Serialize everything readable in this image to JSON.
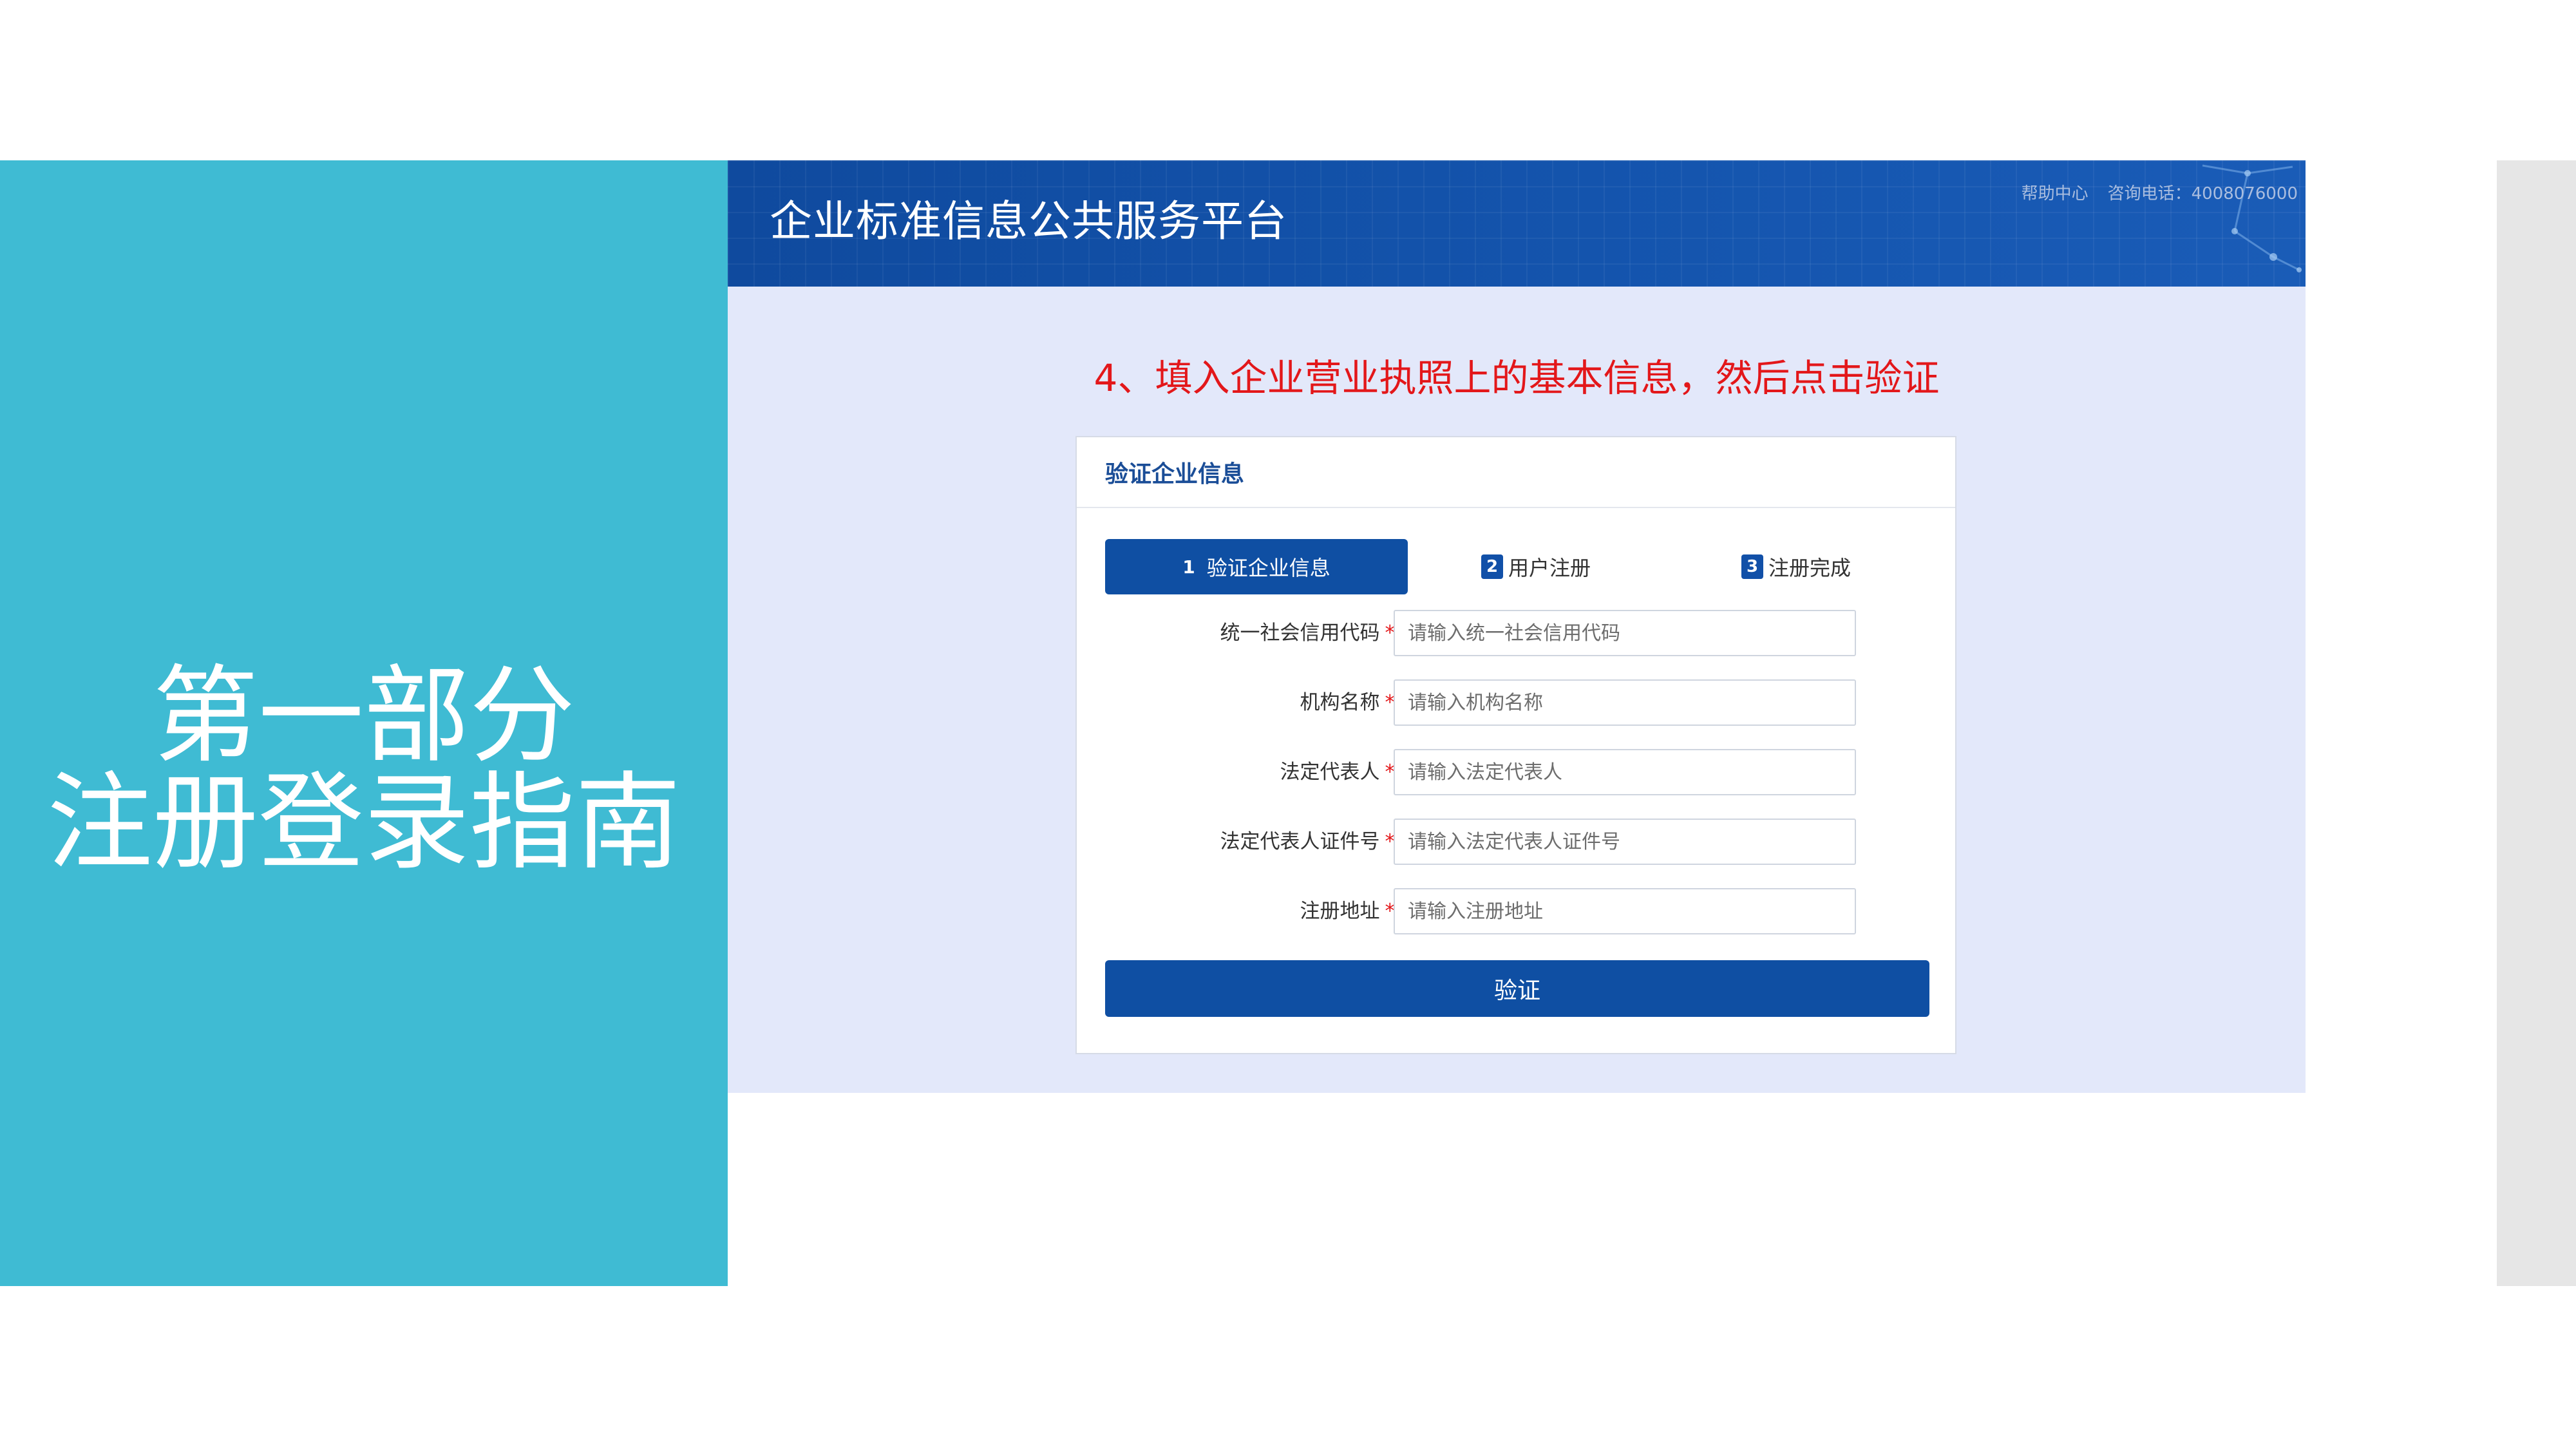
{
  "slide": {
    "title_line1": "第一部分",
    "title_line2": "注册登录指南"
  },
  "screenshot": {
    "platform_title": "企业标准信息公共服务平台",
    "help_center": "帮助中心",
    "hotline": "咨询电话：4008076000",
    "instruction": "4、填入企业营业执照上的基本信息，然后点击验证"
  },
  "card": {
    "title": "验证企业信息",
    "steps": [
      {
        "number": "1",
        "label": "验证企业信息",
        "active": true
      },
      {
        "number": "2",
        "label": "用户注册",
        "active": false
      },
      {
        "number": "3",
        "label": "注册完成",
        "active": false
      }
    ],
    "required_mark": "*",
    "fields": [
      {
        "label": "统一社会信用代码",
        "placeholder": "请输入统一社会信用代码",
        "value": ""
      },
      {
        "label": "机构名称",
        "placeholder": "请输入机构名称",
        "value": ""
      },
      {
        "label": "法定代表人",
        "placeholder": "请输入法定代表人",
        "value": ""
      },
      {
        "label": "法定代表人证件号",
        "placeholder": "请输入法定代表人证件号",
        "value": ""
      },
      {
        "label": "注册地址",
        "placeholder": "请输入注册地址",
        "value": ""
      }
    ],
    "submit_label": "验证"
  },
  "colors": {
    "left_panel": "#3fbbd3",
    "header_blue": "#1454ad",
    "primary_button": "#0f4fa3",
    "instruction_red": "#e3171a",
    "content_background": "#e3e8fa"
  },
  "icons": [
    "network-lines-icon"
  ]
}
